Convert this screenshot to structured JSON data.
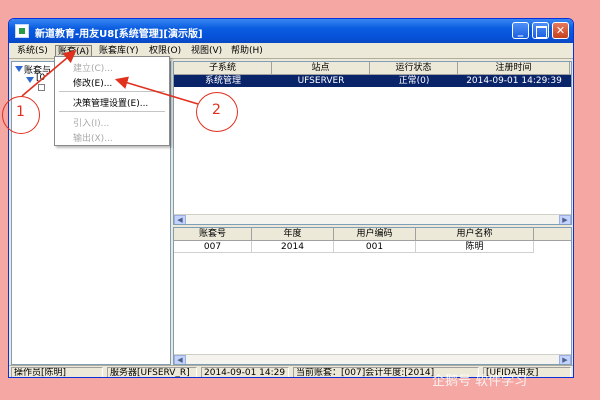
{
  "window": {
    "title": "新道教育-用友U8[系统管理][演示版]",
    "min_label": "_",
    "close_label": "✕"
  },
  "menubar": {
    "items": [
      {
        "label": "系统(S)"
      },
      {
        "label": "账套(A)"
      },
      {
        "label": "账套库(Y)"
      },
      {
        "label": "权限(O)"
      },
      {
        "label": "视图(V)"
      },
      {
        "label": "帮助(H)"
      }
    ]
  },
  "tree": {
    "root_label": "账套与",
    "child_label": "[0"
  },
  "dropdown": {
    "items": [
      {
        "label": "建立(C)...",
        "enabled": false
      },
      {
        "label": "修改(E)...",
        "enabled": true
      },
      {
        "label": "决策管理设置(E)...",
        "enabled": true
      },
      {
        "label": "引入(I)...",
        "enabled": false
      },
      {
        "label": "输出(X)...",
        "enabled": false
      }
    ]
  },
  "top_table": {
    "headers": [
      "子系统",
      "站点",
      "运行状态",
      "注册时间"
    ],
    "rows": [
      {
        "subsystem": "系统管理",
        "site": "UFSERVER",
        "status": "正常(0)",
        "time": "2014-09-01 14:29:39"
      }
    ]
  },
  "bottom_table": {
    "headers": [
      "账套号",
      "年度",
      "用户编码",
      "用户名称"
    ],
    "rows": [
      {
        "account": "007",
        "year": "2014",
        "user_code": "001",
        "user_name": "陈明"
      }
    ]
  },
  "statusbar": {
    "operator": "操作员[陈明]",
    "server": "服务器[UFSERV_R]",
    "datetime": "2014-09-01 14:29",
    "current_account": "当前账套：[007]会计年度:[2014]",
    "brand": "[UFIDA用友]"
  },
  "annotations": {
    "label_1": "1",
    "label_2": "2",
    "color": "#e0301e"
  },
  "watermark": "企鹅号 软件学习"
}
